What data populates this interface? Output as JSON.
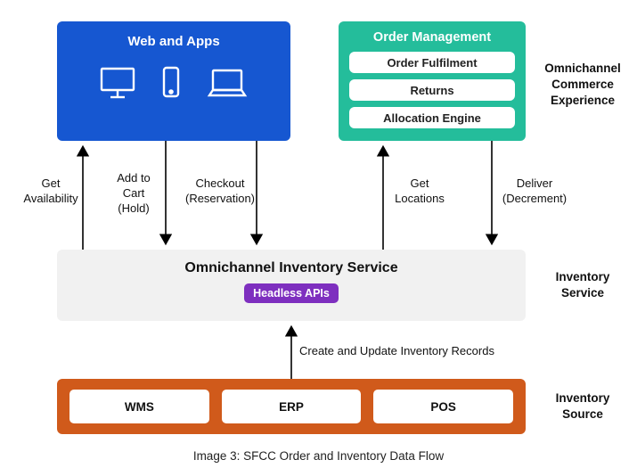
{
  "web_apps": {
    "title": "Web and Apps"
  },
  "order_mgmt": {
    "title": "Order Management",
    "items": [
      "Order Fulfilment",
      "Returns",
      "Allocation Engine"
    ]
  },
  "right_labels": {
    "top": "Omnichannel\nCommerce\nExperience",
    "mid": "Inventory\nService",
    "bottom": "Inventory\nSource"
  },
  "arrows": {
    "get_availability": "Get\nAvailability",
    "add_to_cart": "Add to\nCart\n(Hold)",
    "checkout": "Checkout\n(Reservation)",
    "get_locations": "Get\nLocations",
    "deliver": "Deliver\n(Decrement)",
    "create_update": "Create and Update Inventory Records"
  },
  "inv_service": {
    "title": "Omnichannel Inventory Service",
    "badge": "Headless APIs"
  },
  "inv_source": {
    "items": [
      "WMS",
      "ERP",
      "POS"
    ]
  },
  "caption": "Image 3: SFCC Order and Inventory Data Flow"
}
